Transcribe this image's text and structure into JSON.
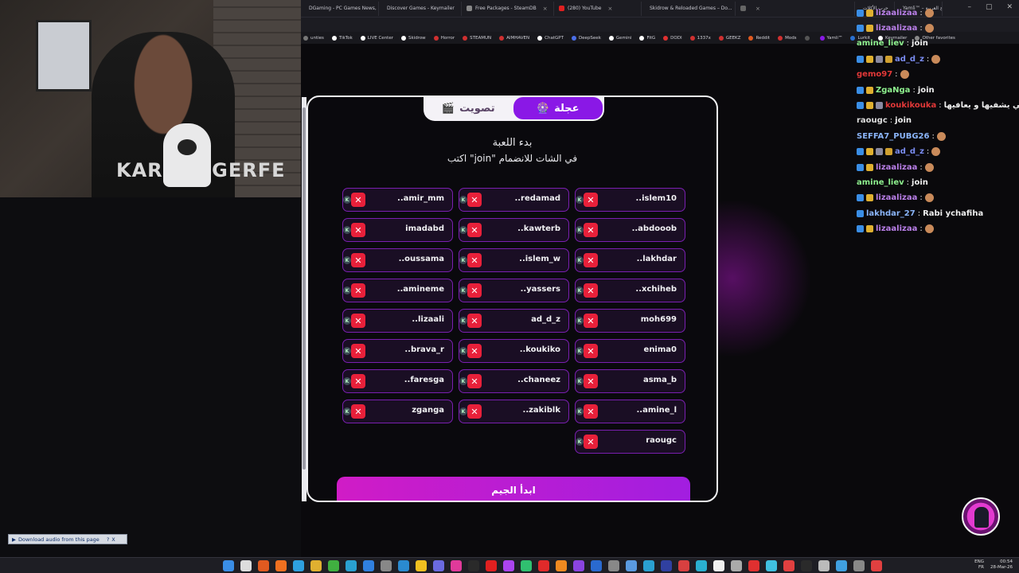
{
  "browser": {
    "tabs": [
      {
        "label": "DGaming - PC Games News, S...",
        "color": "#4a7bd8"
      },
      {
        "label": "Discover Games - Keymailer",
        "color": "#e04848"
      },
      {
        "label": "Free Packages - SteamDB",
        "color": "#888888"
      },
      {
        "label": "(280) YouTube",
        "color": "#e02020"
      },
      {
        "label": "Skidrow & Reloaded Games – Do...",
        "color": "#aaaaaa"
      },
      {
        "label": "",
        "color": "#666666"
      },
      {
        "label": "حرب الأكلات",
        "color": "#e04848"
      },
      {
        "label": "Yamli™ – لوحة المفاتيح العربية...",
        "color": "#8a18e6"
      }
    ],
    "bookmarks": [
      {
        "label": "unties",
        "color": "#777777"
      },
      {
        "label": "TikTok",
        "color": "#ffffff"
      },
      {
        "label": "LIVE Center",
        "color": "#ffffff"
      },
      {
        "label": "Skidrow",
        "color": "#ffffff"
      },
      {
        "label": "Horror",
        "color": "#d03030"
      },
      {
        "label": "STEAMUN",
        "color": "#d03030"
      },
      {
        "label": "AIMHAVEN",
        "color": "#d03030"
      },
      {
        "label": "ChatGPT",
        "color": "#ffffff"
      },
      {
        "label": "DeepSeek",
        "color": "#4a6ee8"
      },
      {
        "label": "Gemini",
        "color": "#ffffff"
      },
      {
        "label": "FitG",
        "color": "#ffffff"
      },
      {
        "label": "DODI",
        "color": "#e03030"
      },
      {
        "label": "1337x",
        "color": "#d03030"
      },
      {
        "label": "GEEKZ",
        "color": "#d03030"
      },
      {
        "label": "Reddit",
        "color": "#e05a20"
      },
      {
        "label": "Mods",
        "color": "#d03030"
      },
      {
        "label": "",
        "color": "#555555"
      },
      {
        "label": "Yamli™",
        "color": "#8a18e6"
      },
      {
        "label": "Lurkit",
        "color": "#2a70d0"
      },
      {
        "label": "Keymailer",
        "color": "#ffffff"
      },
      {
        "label": "Other favorites",
        "color": "#888888"
      }
    ]
  },
  "webcam": {
    "shirt_text": "KARL LAGERFE"
  },
  "download_bar": {
    "label": "Download audio from this page",
    "help": "?",
    "close": "X"
  },
  "game": {
    "mode_tabs": {
      "active_label": "عجلة",
      "active_icon": "🎡",
      "inactive_label": "تصويت",
      "inactive_icon": "🎬"
    },
    "heading": "بدء اللعبة",
    "instruction": "اكتب \"join\" في الشات للانضمام",
    "remove_symbol": "✕",
    "k_badge": "K",
    "players": [
      {
        "name": "..islem10",
        "col": 0,
        "row": 0
      },
      {
        "name": "..redamad",
        "col": 1,
        "row": 0
      },
      {
        "name": "..amir_mm",
        "col": 2,
        "row": 0
      },
      {
        "name": "..abdooob",
        "col": 0,
        "row": 1
      },
      {
        "name": "..kawterb",
        "col": 1,
        "row": 1
      },
      {
        "name": "imadabd",
        "col": 2,
        "row": 1
      },
      {
        "name": "..lakhdar",
        "col": 0,
        "row": 2
      },
      {
        "name": "..islem_w",
        "col": 1,
        "row": 2
      },
      {
        "name": "..oussama",
        "col": 2,
        "row": 2
      },
      {
        "name": "..xchiheb",
        "col": 0,
        "row": 3
      },
      {
        "name": "..yassers",
        "col": 1,
        "row": 3
      },
      {
        "name": "..amineme",
        "col": 2,
        "row": 3
      },
      {
        "name": "moh699",
        "col": 0,
        "row": 4
      },
      {
        "name": "ad_d_z",
        "col": 1,
        "row": 4
      },
      {
        "name": "..lizaali",
        "col": 2,
        "row": 4
      },
      {
        "name": "enima0",
        "col": 0,
        "row": 5
      },
      {
        "name": "..koukiko",
        "col": 1,
        "row": 5
      },
      {
        "name": "..brava_r",
        "col": 2,
        "row": 5
      },
      {
        "name": "asma_b",
        "col": 0,
        "row": 6
      },
      {
        "name": "..chaneez",
        "col": 1,
        "row": 6
      },
      {
        "name": "..faresga",
        "col": 2,
        "row": 6
      },
      {
        "name": "..amine_l",
        "col": 0,
        "row": 7
      },
      {
        "name": "..zakiblk",
        "col": 1,
        "row": 7
      },
      {
        "name": "zganga",
        "col": 2,
        "row": 7
      },
      {
        "name": "raougc",
        "col": 0,
        "row": 8
      }
    ],
    "start_button": "ابدأ الجيم"
  },
  "chat": [
    {
      "user": "lizaalizaa",
      "color": "#b97fe8",
      "sep": ":",
      "text": "",
      "badges": 2,
      "emote": true
    },
    {
      "user": "lizaalizaa",
      "color": "#b97fe8",
      "sep": ":",
      "text": "",
      "badges": 2,
      "emote": true
    },
    {
      "user": "amine_liev",
      "color": "#8ef08e",
      "sep": ":",
      "text": "join",
      "badges": 0,
      "emote": false
    },
    {
      "user": "ad_d_z",
      "color": "#7a8cf0",
      "sep": ":",
      "text": "",
      "badges": 4,
      "emote": true
    },
    {
      "user": "gemo97",
      "color": "#e23838",
      "sep": ":",
      "text": "",
      "badges": 0,
      "emote": true
    },
    {
      "user": "ZgaNga",
      "color": "#8ef08e",
      "sep": ":",
      "text": "join",
      "badges": 2,
      "emote": false
    },
    {
      "user": "koukikouka",
      "color": "#e23838",
      "sep": ":",
      "text": "ربي يشفيها و يعافيها",
      "badges": 3,
      "emote": false
    },
    {
      "user": "raougc",
      "color": "#dddddd",
      "sep": ":",
      "text": "join",
      "badges": 0,
      "emote": false
    },
    {
      "user": "SEFFA7_PUBG26",
      "color": "#8ab4f8",
      "sep": ":",
      "text": "",
      "badges": 0,
      "emote": true
    },
    {
      "user": "ad_d_z",
      "color": "#7a8cf0",
      "sep": ":",
      "text": "",
      "badges": 4,
      "emote": true
    },
    {
      "user": "lizaalizaa",
      "color": "#b97fe8",
      "sep": ":",
      "text": "",
      "badges": 2,
      "emote": true
    },
    {
      "user": "amine_liev",
      "color": "#8ef08e",
      "sep": ":",
      "text": "join",
      "badges": 0,
      "emote": false
    },
    {
      "user": "lizaalizaa",
      "color": "#b97fe8",
      "sep": ":",
      "text": "",
      "badges": 2,
      "emote": true
    },
    {
      "user": "lakhdar_27",
      "color": "#8ab4f8",
      "sep": ":",
      "text": "Rabi ychafiha",
      "badges": 1,
      "emote": false
    },
    {
      "user": "lizaalizaa",
      "color": "#b97fe8",
      "sep": ":",
      "text": "",
      "badges": 2,
      "emote": true
    }
  ],
  "taskbar": {
    "lang_top": "ENG",
    "lang_bottom": "FR",
    "time": "00:54",
    "date": "28-Mar-26",
    "icons": [
      "#3a8ee6",
      "#dddddd",
      "#e05a20",
      "#f07020",
      "#2ea0e0",
      "#e0b030",
      "#40b040",
      "#2aa0d0",
      "#3080e0",
      "#888888",
      "#2a8ad0",
      "#f0c020",
      "#6a6ae0",
      "#e03a9a",
      "#2a2a2a",
      "#e02020",
      "#aa44ee",
      "#30c070",
      "#e02a2a",
      "#f08a20",
      "#8a44e0",
      "#2a6ad0",
      "#888888",
      "#5a9ae0",
      "#2aa0d0",
      "#3040a0",
      "#d84040",
      "#2ab0d0",
      "#f0f0f0",
      "#aaaaaa",
      "#e03030",
      "#40c0e0",
      "#e04040",
      "#2a2a2a",
      "#bbbbbb",
      "#40a0e0",
      "#888888",
      "#e04040"
    ]
  }
}
